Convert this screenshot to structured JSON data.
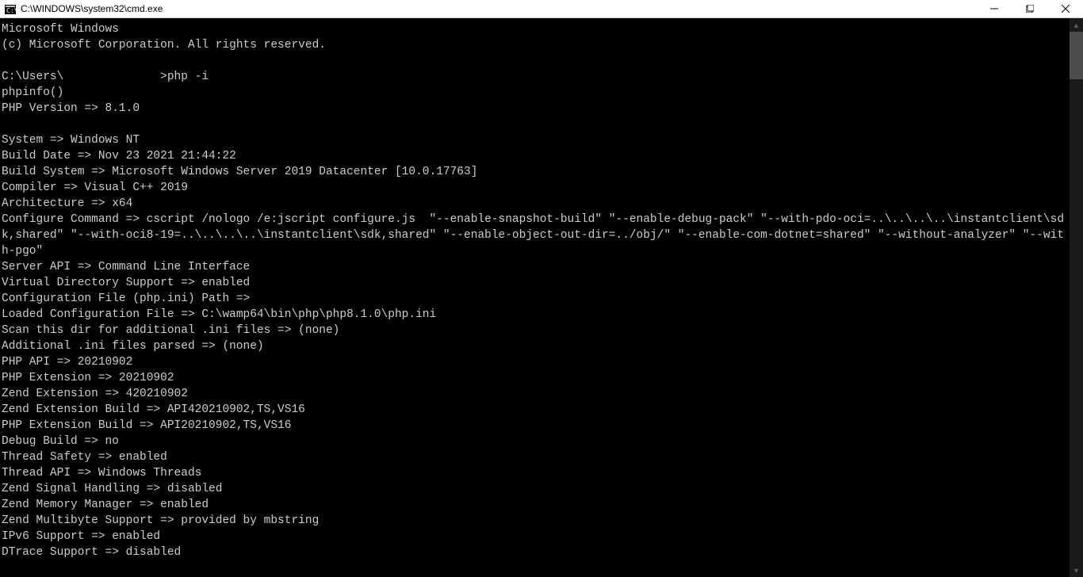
{
  "titlebar": {
    "title": "C:\\WINDOWS\\system32\\cmd.exe"
  },
  "terminal": {
    "lines": [
      "Microsoft Windows ",
      "(c) Microsoft Corporation. All rights reserved.",
      "",
      "C:\\Users\\              >php -i",
      "phpinfo()",
      "PHP Version => 8.1.0",
      "",
      "System => Windows NT ",
      "Build Date => Nov 23 2021 21:44:22",
      "Build System => Microsoft Windows Server 2019 Datacenter [10.0.17763]",
      "Compiler => Visual C++ 2019",
      "Architecture => x64",
      "Configure Command => cscript /nologo /e:jscript configure.js  \"--enable-snapshot-build\" \"--enable-debug-pack\" \"--with-pdo-oci=..\\..\\..\\..\\instantclient\\sdk,shared\" \"--with-oci8-19=..\\..\\..\\..\\instantclient\\sdk,shared\" \"--enable-object-out-dir=../obj/\" \"--enable-com-dotnet=shared\" \"--without-analyzer\" \"--with-pgo\"",
      "Server API => Command Line Interface",
      "Virtual Directory Support => enabled",
      "Configuration File (php.ini) Path =>",
      "Loaded Configuration File => C:\\wamp64\\bin\\php\\php8.1.0\\php.ini",
      "Scan this dir for additional .ini files => (none)",
      "Additional .ini files parsed => (none)",
      "PHP API => 20210902",
      "PHP Extension => 20210902",
      "Zend Extension => 420210902",
      "Zend Extension Build => API420210902,TS,VS16",
      "PHP Extension Build => API20210902,TS,VS16",
      "Debug Build => no",
      "Thread Safety => enabled",
      "Thread API => Windows Threads",
      "Zend Signal Handling => disabled",
      "Zend Memory Manager => enabled",
      "Zend Multibyte Support => provided by mbstring",
      "IPv6 Support => enabled",
      "DTrace Support => disabled"
    ]
  }
}
